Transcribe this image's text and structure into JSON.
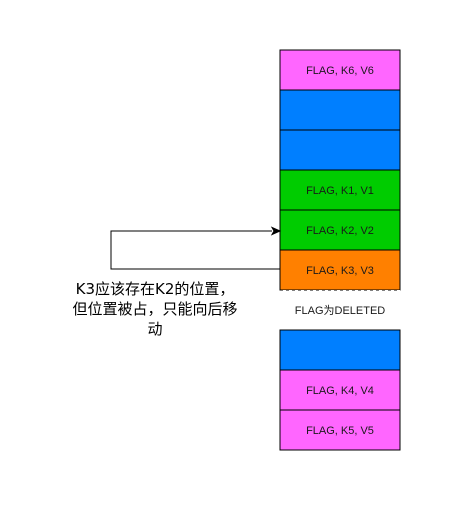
{
  "slots": [
    {
      "label": "FLAG, K6, V6",
      "color": "#ff66ff"
    },
    {
      "label": "",
      "color": "#007fff"
    },
    {
      "label": "",
      "color": "#007fff"
    },
    {
      "label": "FLAG, K1, V1",
      "color": "#00cc00"
    },
    {
      "label": "FLAG, K2, V2",
      "color": "#00cc00"
    },
    {
      "label": "FLAG, K3, V3",
      "color": "#ff8000"
    },
    {
      "label": "FLAG为DELETED",
      "color": "#ffffff",
      "dashed": true
    },
    {
      "label": "",
      "color": "#007fff"
    },
    {
      "label": "FLAG, K4, V4",
      "color": "#ff66ff"
    },
    {
      "label": "FLAG, K5, V5",
      "color": "#ff66ff"
    }
  ],
  "note": {
    "line1": "K3应该存在K2的位置，",
    "line2": "但位置被占，只能向后移",
    "line3": "动"
  },
  "colors": {
    "stroke": "#000000",
    "arrow": "#000000"
  }
}
